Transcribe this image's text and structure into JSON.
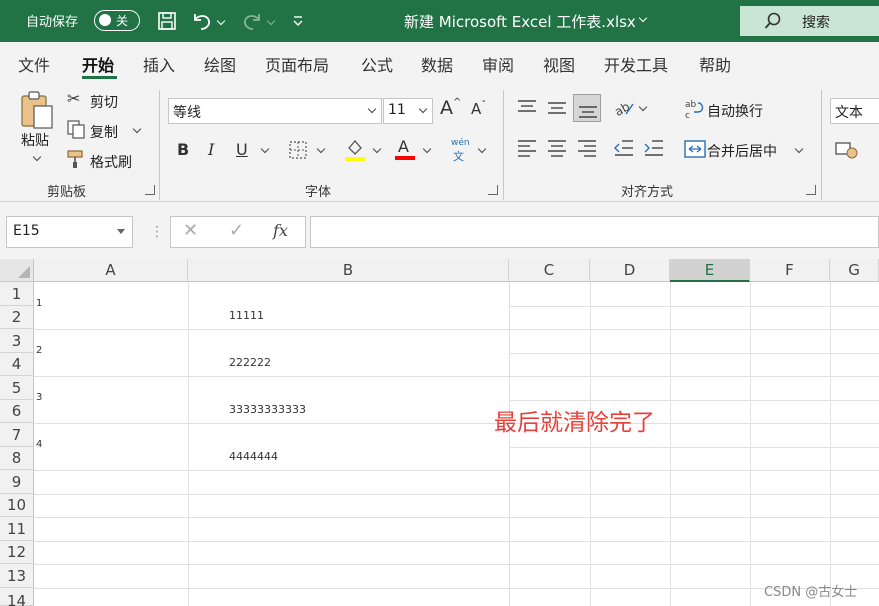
{
  "titlebar": {
    "autosave_label": "自动保存",
    "autosave_state": "关",
    "title": "新建 Microsoft Excel 工作表.xlsx",
    "search_label": "搜索"
  },
  "menu": {
    "tabs": [
      "文件",
      "开始",
      "插入",
      "绘图",
      "页面布局",
      "公式",
      "数据",
      "审阅",
      "视图",
      "开发工具",
      "帮助"
    ],
    "active": "开始"
  },
  "ribbon": {
    "clipboard": {
      "paste": "粘贴",
      "cut": "剪切",
      "copy": "复制",
      "format_painter": "格式刷",
      "label": "剪贴板"
    },
    "font": {
      "font_name": "等线",
      "font_size": "11",
      "bold": "B",
      "italic": "I",
      "underline": "U",
      "phonetic_top": "wén",
      "phonetic_bottom": "文",
      "label": "字体",
      "highlight_color": "#ffff00",
      "font_color": "#ff0000"
    },
    "alignment": {
      "wrap_text": "自动换行",
      "merge_center": "合并后居中",
      "label": "对齐方式"
    },
    "number": {
      "format": "文本"
    }
  },
  "formula_bar": {
    "name_box": "E15",
    "fx": "fx",
    "value": ""
  },
  "sheet": {
    "columns": [
      "A",
      "B",
      "C",
      "D",
      "E",
      "F",
      "G"
    ],
    "selected_column": "E",
    "rows": [
      "1",
      "2",
      "3",
      "4",
      "5",
      "6",
      "7",
      "8",
      "9",
      "10",
      "11",
      "12",
      "13",
      "14"
    ],
    "merged_a": [
      "1",
      "2",
      "3",
      "4"
    ],
    "merged_b": [
      "11111",
      "222222",
      "33333333333",
      "4444444"
    ],
    "note": "最后就清除完了"
  },
  "watermark": "CSDN @古女士",
  "colors": {
    "accent": "#217346",
    "note": "#e8413a"
  }
}
